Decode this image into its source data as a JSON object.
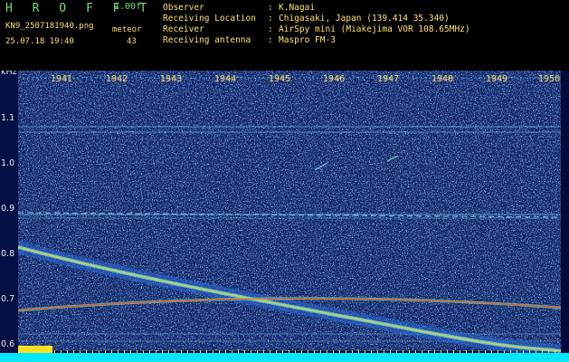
{
  "header": {
    "app_title": "H R O F F T",
    "version": "1.00f",
    "filename": "KN9_2507181940.png",
    "datetime": "25.07.18 19:40",
    "meteor_label": "meteor",
    "meteor_count": "43"
  },
  "info": [
    {
      "key": "Observer",
      "value": "K.Nagai"
    },
    {
      "key": "Receiving Location",
      "value": "Chigasaki, Japan (139.414 35.340)"
    },
    {
      "key": "Receiver",
      "value": "AirSpy mini (Miakejima VOR 108.65MHz)"
    },
    {
      "key": "Receiving antenna",
      "value": "Maspro FM-3"
    }
  ],
  "axis": {
    "unit": "kHz",
    "y_ticks": [
      "1.1",
      "1.0",
      "0.9",
      "0.8",
      "0.7",
      "0.6"
    ]
  },
  "time_markers": [
    "1941",
    "1942",
    "1943",
    "1944",
    "1945",
    "1946",
    "1947",
    "1948",
    "1949",
    "1950"
  ],
  "colors": {
    "background": "#000000",
    "noise_low": "#0a1a6a",
    "noise_mid": "#2a6ad8",
    "signal_high": "#ffd030",
    "signal_peak": "#ff4020",
    "power_bar": "#00e6ff",
    "text_green": "#6ee06e",
    "text_yellow": "#ffe066"
  }
}
